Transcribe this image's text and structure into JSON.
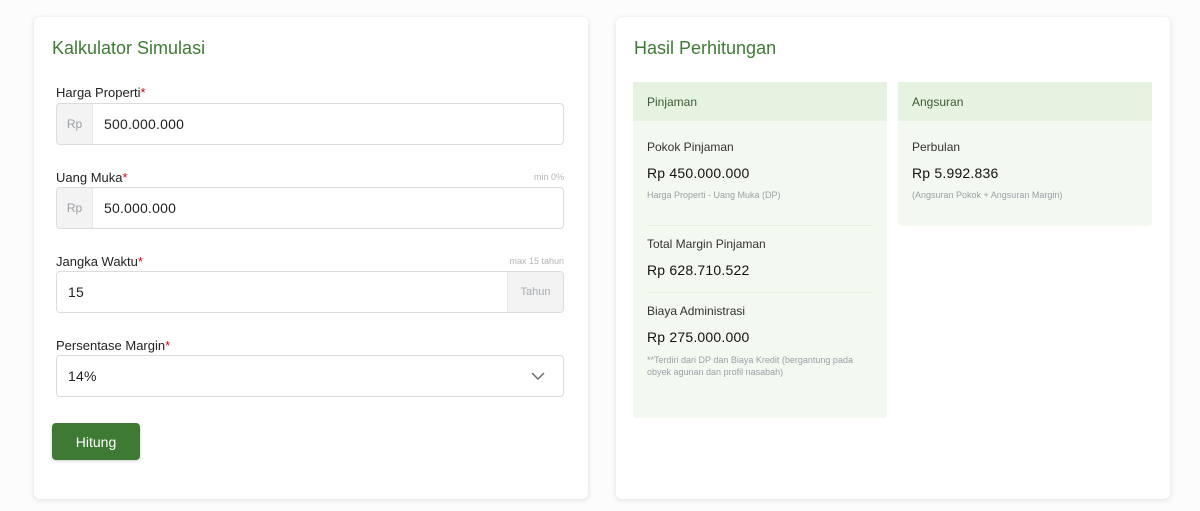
{
  "calculator": {
    "title": "Kalkulator Simulasi",
    "fields": {
      "harga": {
        "label": "Harga Properti",
        "required_mark": "*",
        "prefix": "Rp",
        "value": "500.000.000"
      },
      "uang_muka": {
        "label": "Uang Muka",
        "required_mark": "*",
        "hint": "min 0%",
        "prefix": "Rp",
        "value": "50.000.000"
      },
      "jangka": {
        "label": "Jangka Waktu",
        "required_mark": "*",
        "hint": "max 15 tahun",
        "value": "15",
        "suffix": "Tahun"
      },
      "margin": {
        "label": "Persentase Margin",
        "required_mark": "*",
        "selected": "14%"
      }
    },
    "submit_label": "Hitung"
  },
  "result": {
    "title": "Hasil Perhitungan",
    "pinjaman": {
      "header": "Pinjaman",
      "pokok_label": "Pokok Pinjaman",
      "pokok_value": "Rp 450.000.000",
      "pokok_note": "Harga Properti - Uang Muka (DP)",
      "margin_label": "Total Margin Pinjaman",
      "margin_value": "Rp 628.710.522",
      "admin_label": "Biaya Administrasi",
      "admin_value": "Rp 275.000.000",
      "admin_note": "**Terdiri dari DP dan Biaya Kredit (bergantung pada obyek agunan dan profil nasabah)"
    },
    "angsuran": {
      "header": "Angsuran",
      "perbulan_label": "Perbulan",
      "perbulan_value": "Rp 5.992.836",
      "perbulan_note": "(Angsuran Pokok + Angsuran Margin)"
    }
  },
  "colors": {
    "brand_green": "#3f7a34",
    "panel_bg": "#f3f9f0",
    "panel_head_bg": "#e6f3e1",
    "required_red": "#d0021b"
  },
  "icons": {
    "select_arrow": "chevron-down-icon"
  }
}
